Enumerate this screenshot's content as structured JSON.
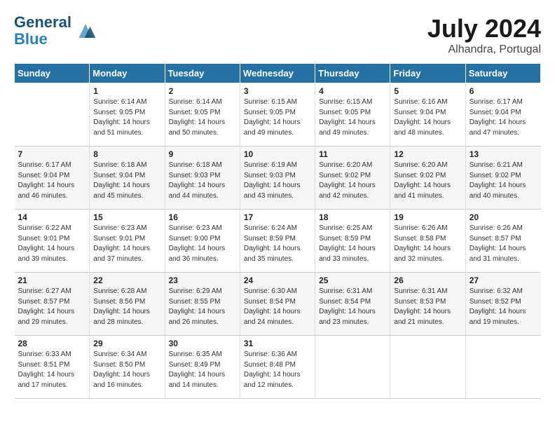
{
  "header": {
    "logo_line1": "General",
    "logo_line2": "Blue",
    "month_title": "July 2024",
    "subtitle": "Alhandra, Portugal"
  },
  "days_of_week": [
    "Sunday",
    "Monday",
    "Tuesday",
    "Wednesday",
    "Thursday",
    "Friday",
    "Saturday"
  ],
  "weeks": [
    [
      {
        "day": "",
        "info": ""
      },
      {
        "day": "1",
        "info": "Sunrise: 6:14 AM\nSunset: 9:05 PM\nDaylight: 14 hours\nand 51 minutes."
      },
      {
        "day": "2",
        "info": "Sunrise: 6:14 AM\nSunset: 9:05 PM\nDaylight: 14 hours\nand 50 minutes."
      },
      {
        "day": "3",
        "info": "Sunrise: 6:15 AM\nSunset: 9:05 PM\nDaylight: 14 hours\nand 49 minutes."
      },
      {
        "day": "4",
        "info": "Sunrise: 6:15 AM\nSunset: 9:05 PM\nDaylight: 14 hours\nand 49 minutes."
      },
      {
        "day": "5",
        "info": "Sunrise: 6:16 AM\nSunset: 9:04 PM\nDaylight: 14 hours\nand 48 minutes."
      },
      {
        "day": "6",
        "info": "Sunrise: 6:17 AM\nSunset: 9:04 PM\nDaylight: 14 hours\nand 47 minutes."
      }
    ],
    [
      {
        "day": "7",
        "info": "Sunrise: 6:17 AM\nSunset: 9:04 PM\nDaylight: 14 hours\nand 46 minutes."
      },
      {
        "day": "8",
        "info": "Sunrise: 6:18 AM\nSunset: 9:04 PM\nDaylight: 14 hours\nand 45 minutes."
      },
      {
        "day": "9",
        "info": "Sunrise: 6:18 AM\nSunset: 9:03 PM\nDaylight: 14 hours\nand 44 minutes."
      },
      {
        "day": "10",
        "info": "Sunrise: 6:19 AM\nSunset: 9:03 PM\nDaylight: 14 hours\nand 43 minutes."
      },
      {
        "day": "11",
        "info": "Sunrise: 6:20 AM\nSunset: 9:02 PM\nDaylight: 14 hours\nand 42 minutes."
      },
      {
        "day": "12",
        "info": "Sunrise: 6:20 AM\nSunset: 9:02 PM\nDaylight: 14 hours\nand 41 minutes."
      },
      {
        "day": "13",
        "info": "Sunrise: 6:21 AM\nSunset: 9:02 PM\nDaylight: 14 hours\nand 40 minutes."
      }
    ],
    [
      {
        "day": "14",
        "info": "Sunrise: 6:22 AM\nSunset: 9:01 PM\nDaylight: 14 hours\nand 39 minutes."
      },
      {
        "day": "15",
        "info": "Sunrise: 6:23 AM\nSunset: 9:01 PM\nDaylight: 14 hours\nand 37 minutes."
      },
      {
        "day": "16",
        "info": "Sunrise: 6:23 AM\nSunset: 9:00 PM\nDaylight: 14 hours\nand 36 minutes."
      },
      {
        "day": "17",
        "info": "Sunrise: 6:24 AM\nSunset: 8:59 PM\nDaylight: 14 hours\nand 35 minutes."
      },
      {
        "day": "18",
        "info": "Sunrise: 6:25 AM\nSunset: 8:59 PM\nDaylight: 14 hours\nand 33 minutes."
      },
      {
        "day": "19",
        "info": "Sunrise: 6:26 AM\nSunset: 8:58 PM\nDaylight: 14 hours\nand 32 minutes."
      },
      {
        "day": "20",
        "info": "Sunrise: 6:26 AM\nSunset: 8:57 PM\nDaylight: 14 hours\nand 31 minutes."
      }
    ],
    [
      {
        "day": "21",
        "info": "Sunrise: 6:27 AM\nSunset: 8:57 PM\nDaylight: 14 hours\nand 29 minutes."
      },
      {
        "day": "22",
        "info": "Sunrise: 6:28 AM\nSunset: 8:56 PM\nDaylight: 14 hours\nand 28 minutes."
      },
      {
        "day": "23",
        "info": "Sunrise: 6:29 AM\nSunset: 8:55 PM\nDaylight: 14 hours\nand 26 minutes."
      },
      {
        "day": "24",
        "info": "Sunrise: 6:30 AM\nSunset: 8:54 PM\nDaylight: 14 hours\nand 24 minutes."
      },
      {
        "day": "25",
        "info": "Sunrise: 6:31 AM\nSunset: 8:54 PM\nDaylight: 14 hours\nand 23 minutes."
      },
      {
        "day": "26",
        "info": "Sunrise: 6:31 AM\nSunset: 8:53 PM\nDaylight: 14 hours\nand 21 minutes."
      },
      {
        "day": "27",
        "info": "Sunrise: 6:32 AM\nSunset: 8:52 PM\nDaylight: 14 hours\nand 19 minutes."
      }
    ],
    [
      {
        "day": "28",
        "info": "Sunrise: 6:33 AM\nSunset: 8:51 PM\nDaylight: 14 hours\nand 17 minutes."
      },
      {
        "day": "29",
        "info": "Sunrise: 6:34 AM\nSunset: 8:50 PM\nDaylight: 14 hours\nand 16 minutes."
      },
      {
        "day": "30",
        "info": "Sunrise: 6:35 AM\nSunset: 8:49 PM\nDaylight: 14 hours\nand 14 minutes."
      },
      {
        "day": "31",
        "info": "Sunrise: 6:36 AM\nSunset: 8:48 PM\nDaylight: 14 hours\nand 12 minutes."
      },
      {
        "day": "",
        "info": ""
      },
      {
        "day": "",
        "info": ""
      },
      {
        "day": "",
        "info": ""
      }
    ]
  ]
}
